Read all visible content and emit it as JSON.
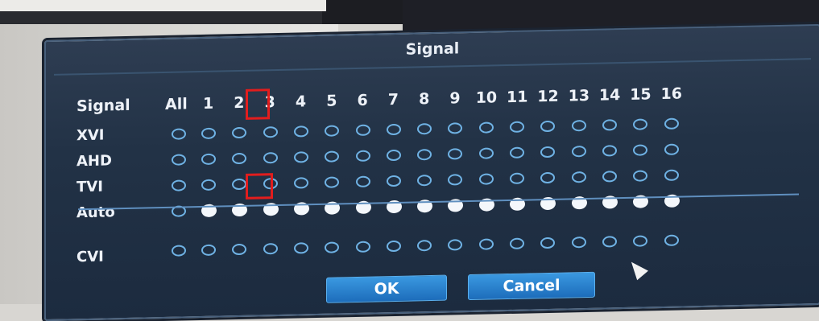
{
  "dialog": {
    "title": "Signal",
    "header_label": "Signal",
    "all_label": "All",
    "channels": [
      "1",
      "2",
      "3",
      "4",
      "5",
      "6",
      "7",
      "8",
      "9",
      "10",
      "11",
      "12",
      "13",
      "14",
      "15",
      "16"
    ],
    "rows": [
      {
        "label": "XVI",
        "selected": []
      },
      {
        "label": "AHD",
        "selected": []
      },
      {
        "label": "TVI",
        "selected": []
      },
      {
        "label": "Auto",
        "selected": [
          1,
          2,
          3,
          4,
          5,
          6,
          7,
          8,
          9,
          10,
          11,
          12,
          13,
          14,
          15,
          16
        ]
      }
    ],
    "cvi_row": {
      "label": "CVI",
      "selected": []
    },
    "highlights": [
      "channel 2 header",
      "TVI channel 2"
    ],
    "ok_label": "OK",
    "cancel_label": "Cancel"
  }
}
